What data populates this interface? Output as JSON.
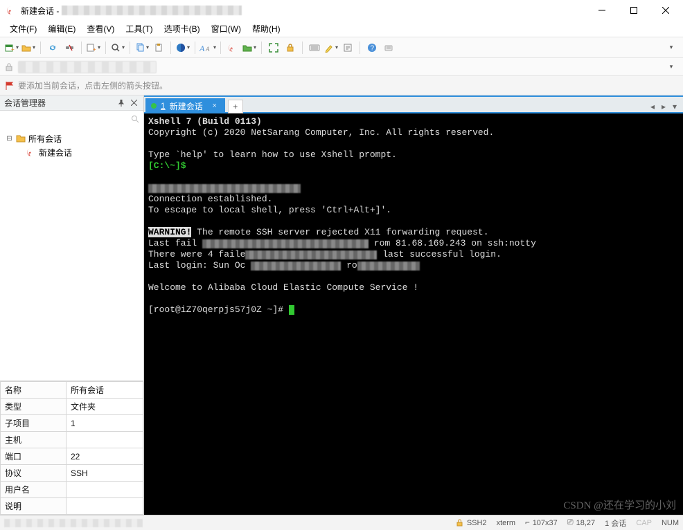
{
  "title": "新建会话 - ",
  "menus": [
    "文件(F)",
    "编辑(E)",
    "查看(V)",
    "工具(T)",
    "选项卡(B)",
    "窗口(W)",
    "帮助(H)"
  ],
  "hint": "要添加当前会话，点击左侧的箭头按钮。",
  "sidebar": {
    "header": "会话管理器",
    "root": "所有会话",
    "child": "新建会话"
  },
  "props": {
    "labels": {
      "name": "名称",
      "type": "类型",
      "subitem": "子项目",
      "host": "主机",
      "port": "端口",
      "proto": "协议",
      "user": "用户名",
      "desc": "说明"
    },
    "values": {
      "name": "所有会话",
      "type": "文件夹",
      "subitem": "1",
      "host": "",
      "port": "22",
      "proto": "SSH",
      "user": "",
      "desc": ""
    }
  },
  "tab": {
    "num": "1",
    "label": "新建会话"
  },
  "term": {
    "l1": "Xshell 7 (Build 0113)",
    "l2": "Copyright (c) 2020 NetSarang Computer, Inc. All rights reserved.",
    "l3": "Type `help' to learn how to use Xshell prompt.",
    "prompt1": "[C:\\~]$",
    "l4": "Connection established.",
    "l5": "To escape to local shell, press 'Ctrl+Alt+]'.",
    "warn": "WARNING!",
    "l6": " The remote SSH server rejected X11 forwarding request.",
    "l7a": "Last fail",
    "l7b": "rom 81.68.169.243 on ssh:notty",
    "l8a": "There were 4 faile",
    "l8b": "last successful login.",
    "l9a": "Last login: Sun Oc",
    "l9b": "ro",
    "l10": "Welcome to Alibaba Cloud Elastic Compute Service !",
    "prompt2": "[root@iZ70qerpjs57j0Z ~]# "
  },
  "status": {
    "ssh": "SSH2",
    "xterm": "xterm",
    "size": "107x37",
    "pos": "18,27",
    "sess": "1 会话",
    "cap": "CAP",
    "num": "NUM"
  },
  "watermark": "CSDN @还在学习的小刘"
}
